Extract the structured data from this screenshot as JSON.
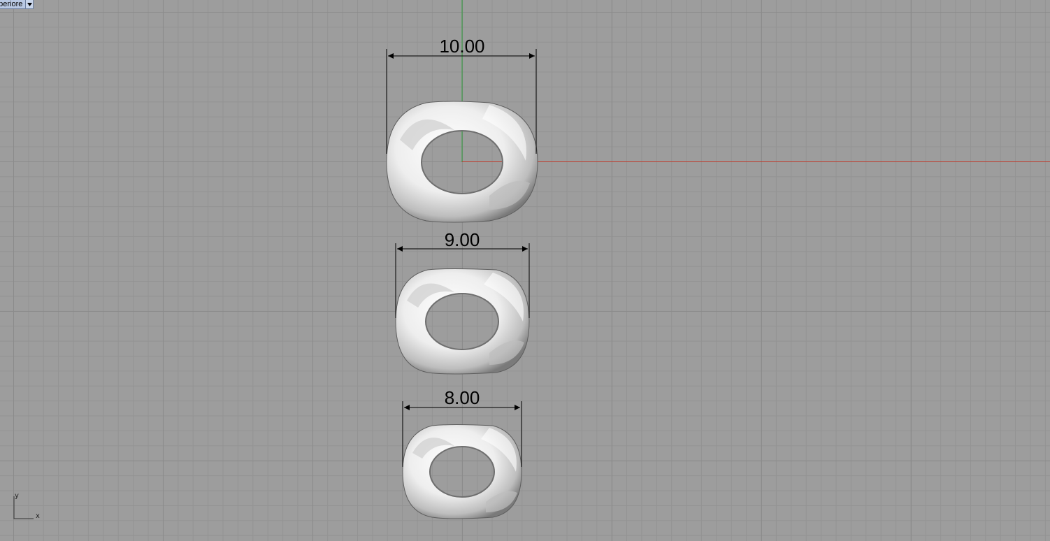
{
  "viewport": {
    "tab_label": "uperiore",
    "dropdown_icon": "triangle-down-icon"
  },
  "dimensions": [
    {
      "label": "10.00"
    },
    {
      "label": "9.00"
    },
    {
      "label": "8.00"
    }
  ],
  "axis_widget": {
    "x_label": "x",
    "y_label": "y"
  },
  "colors": {
    "background": "#9d9d9d",
    "grid_major": "#8b8b8b",
    "grid_minor": "#939393",
    "x_axis": "#c0392b",
    "y_axis": "#2e9e3a",
    "dimension": "#000000"
  }
}
